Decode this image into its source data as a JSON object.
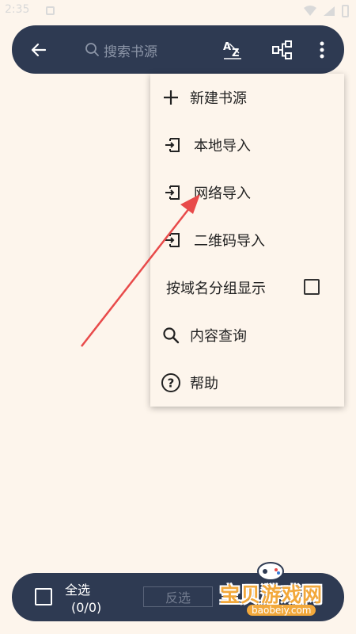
{
  "status_bar": {
    "time": "2:35"
  },
  "toolbar": {
    "search_placeholder": "搜索书源",
    "sort_label": "A͟Z"
  },
  "menu": {
    "items": [
      {
        "label": "新建书源",
        "icon": "plus-icon"
      },
      {
        "label": "本地导入",
        "icon": "import-icon"
      },
      {
        "label": "网络导入",
        "icon": "import-icon"
      },
      {
        "label": "二维码导入",
        "icon": "import-icon"
      },
      {
        "label": "按域名分组显示",
        "checked": false
      },
      {
        "label": "内容查询",
        "icon": "search-icon"
      },
      {
        "label": "帮助",
        "icon": "help-icon"
      }
    ]
  },
  "bottom_bar": {
    "select_all_label": "全选",
    "selection_count": "(0/0)",
    "invert_label": "反选"
  },
  "watermark": {
    "title": "宝贝游戏网",
    "domain": "baobeiy.com"
  },
  "colors": {
    "bar": "#2E3A52",
    "background": "#FDF5EC",
    "arrow": "#E84A4A",
    "watermark": "#F2A83B"
  }
}
